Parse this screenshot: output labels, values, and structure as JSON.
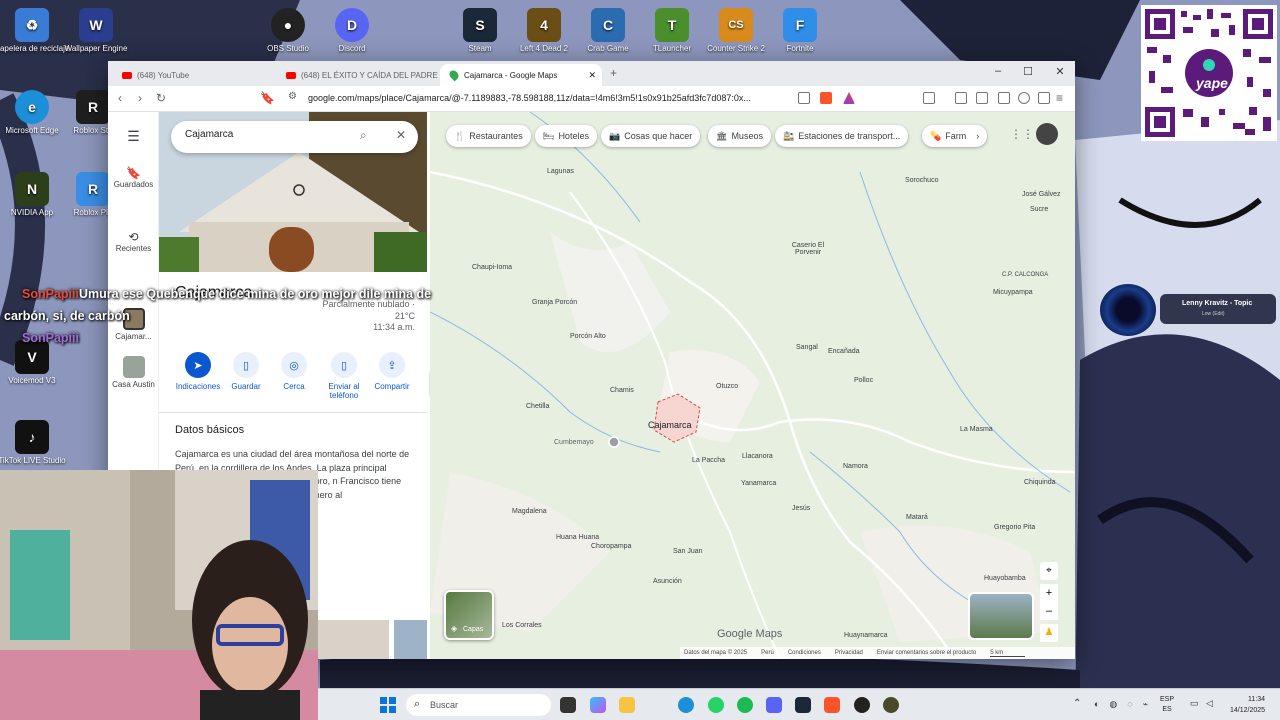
{
  "desktop": {
    "icons": [
      {
        "label": "Papelera de reciclaje",
        "color": "#3a7bd5",
        "glyph": "♻"
      },
      {
        "label": "Wallpaper Engine",
        "color": "#2a3d8f",
        "glyph": "W"
      },
      {
        "label": "OBS Studio",
        "color": "#222222",
        "glyph": "●"
      },
      {
        "label": "Discord",
        "color": "#5865f2",
        "glyph": "D"
      },
      {
        "label": "Steam",
        "color": "#1b2838",
        "glyph": "S"
      },
      {
        "label": "Left 4 Dead 2",
        "color": "#6b4e16",
        "glyph": "4"
      },
      {
        "label": "Crab Game",
        "color": "#2b6cb0",
        "glyph": "C"
      },
      {
        "label": "TLauncher",
        "color": "#4a8f2c",
        "glyph": "T"
      },
      {
        "label": "Counter Strike 2",
        "color": "#d88a1a",
        "glyph": "CS"
      },
      {
        "label": "Fortnite",
        "color": "#2e8ee8",
        "glyph": "F"
      },
      {
        "label": "Microsoft Edge",
        "color": "#1b8fd8",
        "glyph": "e"
      },
      {
        "label": "Roblox Stu",
        "color": "#1f1f1f",
        "glyph": "R"
      },
      {
        "label": "NVIDIA App",
        "color": "#2c3e1a",
        "glyph": "N"
      },
      {
        "label": "Roblox Pla",
        "color": "#3a8ee6",
        "glyph": "R"
      },
      {
        "label": "Voicemod V3",
        "color": "#111111",
        "glyph": "V"
      },
      {
        "label": "TikTok LIVE Studio",
        "color": "#111111",
        "glyph": "♪"
      }
    ]
  },
  "caption": {
    "line1_prefix": "",
    "line1": "Umura ese Quebenque dice mina de oro mejor dile mina de",
    "line2": "carbón, si, de carbón",
    "user": "SonPapiii"
  },
  "browser": {
    "tabs": [
      {
        "label": "(648) YouTube"
      },
      {
        "label": "(648) EL ÉXITO Y CAÍDA DEL PADRE"
      },
      {
        "label": "Cajamarca - Google Maps"
      }
    ],
    "url": "google.com/maps/place/Cajamarca/@-7.1189883,-78.598188,11z/data=!4m6!3m5!1s0x91b25afd3fc7d087:0x..."
  },
  "maps": {
    "rail": [
      {
        "label": "Guardados",
        "icon": "bookmark-icon"
      },
      {
        "label": "Recientes",
        "icon": "history-icon"
      },
      {
        "label": "Cajamar...",
        "icon": "thumb"
      },
      {
        "label": "Casa Austin",
        "icon": "thumb"
      }
    ],
    "search_value": "Cajamarca",
    "place": {
      "title": "Cajamarca",
      "weather": "Parcialmente nublado ·",
      "temp": "21°C",
      "time": "11:34 a.m."
    },
    "actions": [
      {
        "label": "Indicaciones",
        "color": "#0b57d0",
        "glyph": "➤"
      },
      {
        "label": "Guardar",
        "color": "#e8f0fe",
        "glyph": "🔖"
      },
      {
        "label": "Cerca",
        "color": "#e8f0fe",
        "glyph": "◎"
      },
      {
        "label": "Enviar al teléfono",
        "color": "#e8f0fe",
        "glyph": "▯"
      },
      {
        "label": "Compartir",
        "color": "#e8f0fe",
        "glyph": "⇪"
      }
    ],
    "facts_title": "Datos básicos",
    "facts_text": "Cajamarca es una ciudad del área montañosa del norte de Perú, en la cordillera de los Andes. La plaza principal rodeada de Catedral de de pan de oro, n Francisco tiene eligioso. Cerca está el vieron prisionero al",
    "chips": [
      {
        "label": "Restaurantes",
        "icon": "🍴"
      },
      {
        "label": "Hoteles",
        "icon": "🛏"
      },
      {
        "label": "Cosas que hacer",
        "icon": "📷"
      },
      {
        "label": "Museos",
        "icon": "🏛"
      },
      {
        "label": "Estaciones de transport...",
        "icon": "🚉"
      },
      {
        "label": "Farm",
        "icon": "💊"
      }
    ],
    "places": [
      {
        "name": "Lagunas"
      },
      {
        "name": "Sorochuco"
      },
      {
        "name": "José Gálvez"
      },
      {
        "name": "Sucre"
      },
      {
        "name": "Chaupi-Ioma"
      },
      {
        "name": "Caserio El Porvenir"
      },
      {
        "name": "C.P. CALCONGA"
      },
      {
        "name": "Granja Porcón"
      },
      {
        "name": "Micuypampa"
      },
      {
        "name": "Porcón Alto"
      },
      {
        "name": "Sangal"
      },
      {
        "name": "Encañada"
      },
      {
        "name": "Chamis"
      },
      {
        "name": "Otuzco"
      },
      {
        "name": "Polloc"
      },
      {
        "name": "Chetilla"
      },
      {
        "name": "Cajamarca"
      },
      {
        "name": "Cumbemayo"
      },
      {
        "name": "La Masma"
      },
      {
        "name": "Llacanora"
      },
      {
        "name": "Namora"
      },
      {
        "name": "La Paccha"
      },
      {
        "name": "Yanamarca"
      },
      {
        "name": "Chiquinda"
      },
      {
        "name": "Magdalena"
      },
      {
        "name": "Jesús"
      },
      {
        "name": "Matará"
      },
      {
        "name": "Huana Huana"
      },
      {
        "name": "Choropampa"
      },
      {
        "name": "San Juan"
      },
      {
        "name": "Gregorio Pita"
      },
      {
        "name": "Asunción"
      },
      {
        "name": "Huayobamba"
      },
      {
        "name": "Los Corrales"
      },
      {
        "name": "Huaynamarca"
      }
    ],
    "layers_label": "Capas",
    "logo": "Google Maps",
    "footer": [
      "Datos del mapa © 2025",
      "Perú",
      "Condiciones",
      "Privacidad",
      "Enviar comentarios sobre el producto",
      "5 km"
    ]
  },
  "music": {
    "title": "Lenny Kravitz - Topic",
    "sub": "Low (Edit)"
  },
  "qr": {
    "brand": "yape"
  },
  "taskbar": {
    "search_placeholder": "Buscar",
    "lang1": "ESP",
    "lang2": "ES",
    "time": "11:34",
    "date": "14/12/2025"
  }
}
